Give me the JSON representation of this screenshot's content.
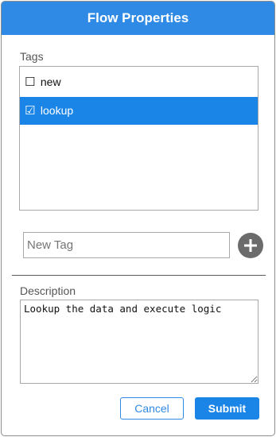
{
  "dialog": {
    "title": "Flow Properties"
  },
  "tags": {
    "label": "Tags",
    "items": [
      {
        "label": "new",
        "checked": false,
        "selected": false,
        "check_glyph": "☐"
      },
      {
        "label": "lookup",
        "checked": true,
        "selected": true,
        "check_glyph": "☑"
      }
    ]
  },
  "new_tag": {
    "value": "",
    "placeholder": "New Tag",
    "add_icon": "plus-icon"
  },
  "description": {
    "label": "Description",
    "value": "Lookup the data and execute logic"
  },
  "buttons": {
    "cancel_label": "Cancel",
    "submit_label": "Submit"
  },
  "colors": {
    "accent": "#2f8ae5",
    "selected_row": "#1a85e6",
    "add_button": "#6b6b6b"
  }
}
